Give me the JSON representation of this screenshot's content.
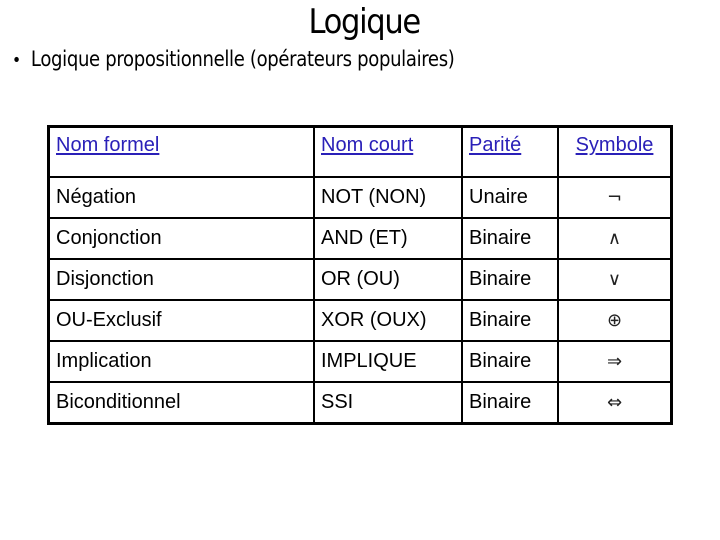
{
  "slide": {
    "title": "Logique",
    "bullet": "Logique propositionnelle (opérateurs populaires)",
    "bullet_marker": "•"
  },
  "table": {
    "headers": [
      "Nom formel",
      "Nom court",
      "Parité",
      "Symbole"
    ],
    "header_link_color": "#2a20b8",
    "rows": [
      {
        "formal": "Négation",
        "short": "NOT (NON)",
        "arity": "Unaire",
        "symbol": "¬",
        "symbol_icon": "negation-icon"
      },
      {
        "formal": "Conjonction",
        "short": "AND (ET)",
        "arity": "Binaire",
        "symbol": "∧",
        "symbol_icon": "logical-and-icon"
      },
      {
        "formal": "Disjonction",
        "short": "OR (OU)",
        "arity": "Binaire",
        "symbol": "∨",
        "symbol_icon": "logical-or-icon"
      },
      {
        "formal": "OU-Exclusif",
        "short": "XOR (OUX)",
        "arity": "Binaire",
        "symbol": "⊕",
        "symbol_icon": "xor-circled-plus-icon"
      },
      {
        "formal": "Implication",
        "short": "IMPLIQUE",
        "arity": "Binaire",
        "symbol": "⇒",
        "symbol_icon": "implies-arrow-icon"
      },
      {
        "formal": "Biconditionnel",
        "short": "SSI",
        "arity": "Binaire",
        "symbol": "⇔",
        "symbol_icon": "iff-double-arrow-icon"
      }
    ]
  }
}
